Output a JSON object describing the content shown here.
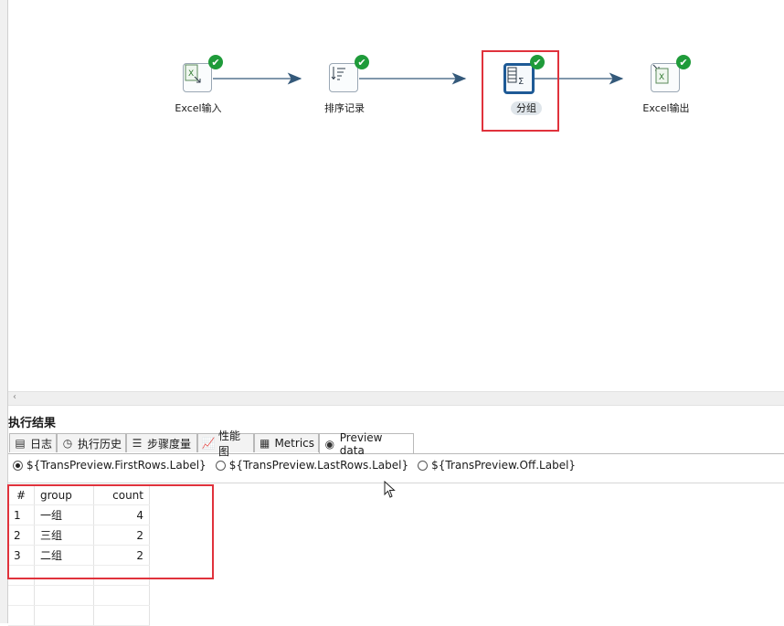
{
  "workflow": {
    "steps": [
      {
        "label": "Excel输入",
        "icon": "excel-input-icon",
        "status": "success"
      },
      {
        "label": "排序记录",
        "icon": "sort-icon",
        "status": "success"
      },
      {
        "label": "分组",
        "icon": "group-by-icon",
        "status": "success",
        "selected": true
      },
      {
        "label": "Excel输出",
        "icon": "excel-output-icon",
        "status": "success"
      }
    ]
  },
  "results": {
    "title": "执行结果",
    "tabs": [
      {
        "label": "日志",
        "icon": "log-icon"
      },
      {
        "label": "执行历史",
        "icon": "history-icon"
      },
      {
        "label": "步骤度量",
        "icon": "step-metrics-icon"
      },
      {
        "label": "性能图",
        "icon": "performance-chart-icon"
      },
      {
        "label": "Metrics",
        "icon": "metrics-icon"
      },
      {
        "label": "Preview data",
        "icon": "preview-eye-icon",
        "active": true
      }
    ],
    "radios": [
      {
        "label": "${TransPreview.FirstRows.Label}",
        "checked": true
      },
      {
        "label": "${TransPreview.LastRows.Label}",
        "checked": false
      },
      {
        "label": "${TransPreview.Off.Label}",
        "checked": false
      }
    ],
    "table": {
      "columns": [
        "#",
        "group",
        "count"
      ],
      "rows": [
        [
          "1",
          "一组",
          "4"
        ],
        [
          "2",
          "三组",
          "2"
        ],
        [
          "3",
          "二组",
          "2"
        ]
      ]
    }
  },
  "colors": {
    "success": "#1f9b3a",
    "highlight": "#e0323c",
    "hop": "#34597a",
    "selected_step": "#1e5a96"
  }
}
